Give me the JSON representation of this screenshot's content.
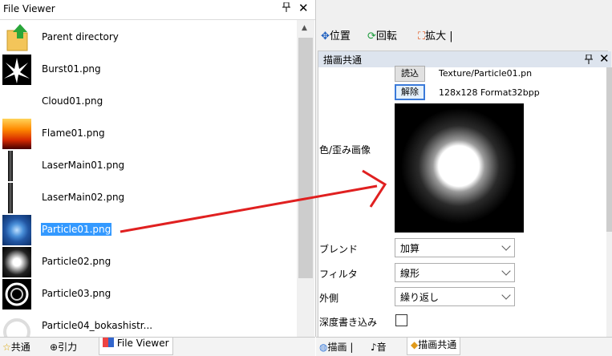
{
  "left_panel": {
    "title": "File Viewer",
    "pin": "ᵖ",
    "close": "✕",
    "files": [
      {
        "label": "Parent directory",
        "thumb": "folder-up-icon",
        "selected": false
      },
      {
        "label": "Burst01.png",
        "thumb": "burst",
        "selected": false
      },
      {
        "label": "Cloud01.png",
        "thumb": "cloud",
        "selected": false
      },
      {
        "label": "Flame01.png",
        "thumb": "flame",
        "selected": false
      },
      {
        "label": "LaserMain01.png",
        "thumb": "laser",
        "selected": false
      },
      {
        "label": "LaserMain02.png",
        "thumb": "laser",
        "selected": false
      },
      {
        "label": "Particle01.png",
        "thumb": "particle-blue",
        "selected": true
      },
      {
        "label": "Particle02.png",
        "thumb": "particle-white",
        "selected": false
      },
      {
        "label": "Particle03.png",
        "thumb": "ring",
        "selected": false
      },
      {
        "label": "Particle04_bokashistr...",
        "thumb": "ring-soft",
        "selected": false
      }
    ],
    "tabs": [
      {
        "label": "共通",
        "icon": "star-icon",
        "active": false
      },
      {
        "label": "引力",
        "icon": "crosshair-icon",
        "active": false
      },
      {
        "label": "File Viewer",
        "icon": "file-viewer-icon",
        "active": true
      }
    ]
  },
  "right_panel": {
    "top_tabs": [
      {
        "label": "位置",
        "icon": "move-icon"
      },
      {
        "label": "回転",
        "icon": "rotate-icon"
      },
      {
        "label": "拡大",
        "icon": "scale-icon"
      }
    ],
    "section_title": "描画共通",
    "pin": "ᵖ",
    "close": "✕",
    "load_button": "読込",
    "texture_path": "Texture/Particle01.pn",
    "release_button": "解除",
    "texture_info": "128x128 Format32bpp",
    "texture_label": "色/歪み画像",
    "blend_label": "ブレンド",
    "blend_value": "加算",
    "filter_label": "フィルタ",
    "filter_value": "線形",
    "wrap_label": "外側",
    "wrap_value": "繰り返し",
    "depth_write_label": "深度書き込み",
    "depth_write_checked": false,
    "bottom_tabs": [
      {
        "label": "描画",
        "icon": "globe-icon",
        "active": false
      },
      {
        "label": "音",
        "icon": "note-icon",
        "active": false
      },
      {
        "label": "描画共通",
        "icon": "cube-icon",
        "active": true
      }
    ]
  },
  "colors": {
    "selection": "#3399ff",
    "section_header": "#dde4ee",
    "arrow": "#e02020"
  }
}
